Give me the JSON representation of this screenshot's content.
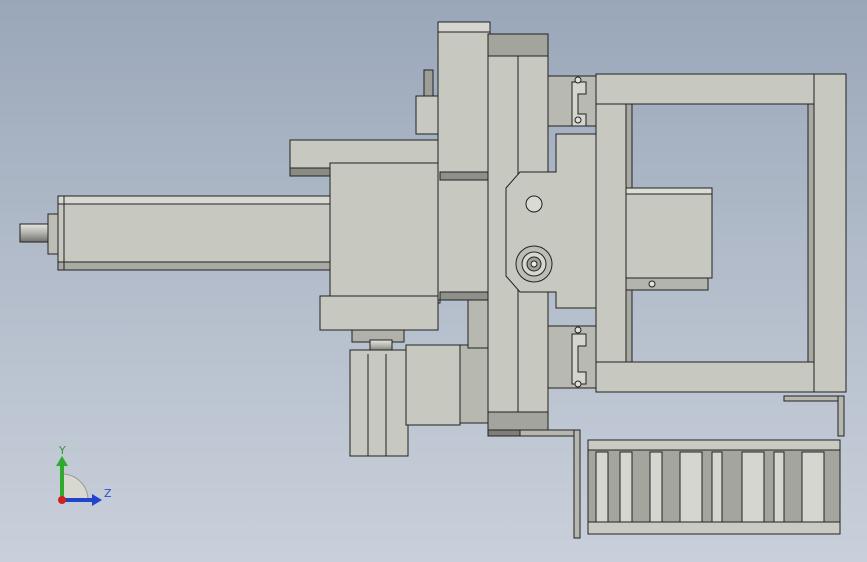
{
  "viewport": {
    "background_top": "#9aa7b9",
    "background_bottom": "#c9d0db"
  },
  "part_colors": {
    "face": "#c7c8bf",
    "face_dark": "#aeafa6",
    "shadow": "#5b5c58",
    "edge": "#222222"
  },
  "triad": {
    "y_label": "Y",
    "z_label": "Z",
    "y_color": "#2faa2f",
    "z_color": "#2244cc",
    "x_color": "#d02020"
  }
}
